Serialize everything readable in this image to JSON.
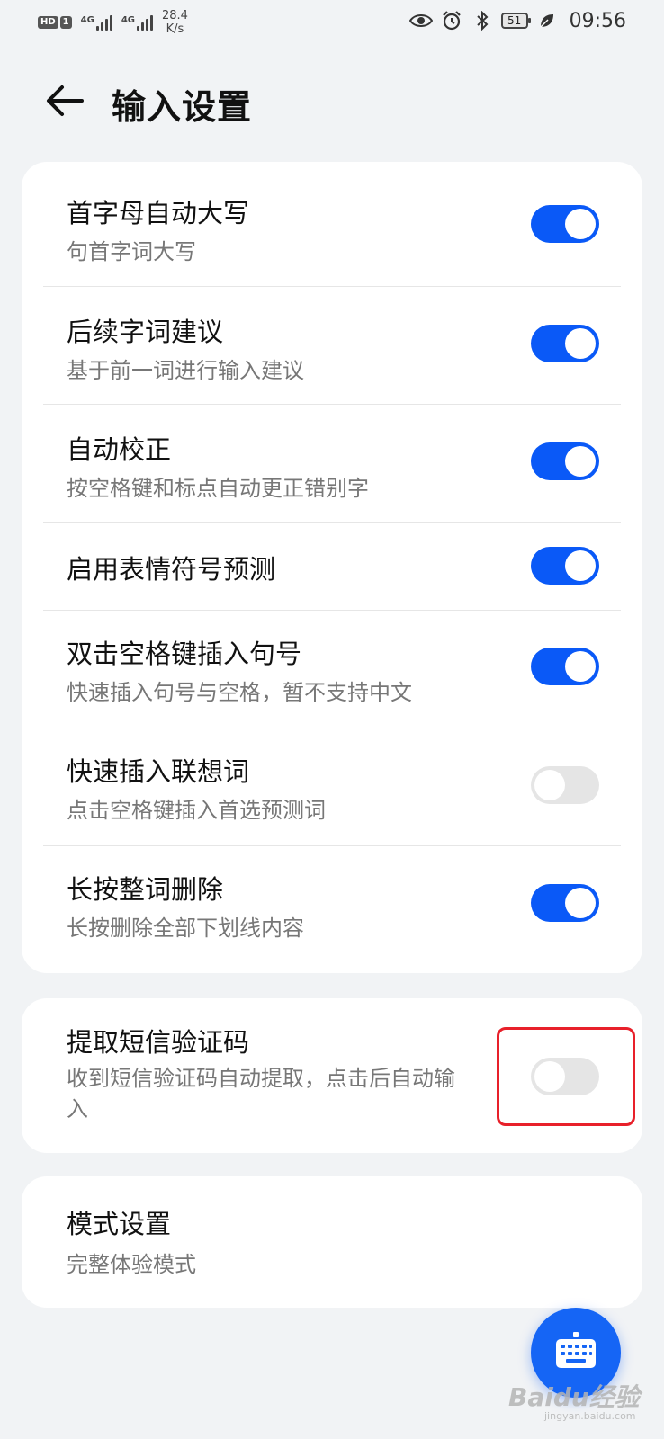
{
  "status": {
    "net_speed_value": "28.4",
    "net_speed_unit": "K/s",
    "signal1": "4G",
    "signal2": "4G",
    "battery": "51",
    "time": "09:56"
  },
  "header": {
    "title": "输入设置"
  },
  "group1": [
    {
      "title": "首字母自动大写",
      "subtitle": "句首字词大写",
      "on": true
    },
    {
      "title": "后续字词建议",
      "subtitle": "基于前一词进行输入建议",
      "on": true
    },
    {
      "title": "自动校正",
      "subtitle": "按空格键和标点自动更正错别字",
      "on": true
    },
    {
      "title": "启用表情符号预测",
      "subtitle": "",
      "on": true
    },
    {
      "title": "双击空格键插入句号",
      "subtitle": "快速插入句号与空格，暂不支持中文",
      "on": true
    },
    {
      "title": "快速插入联想词",
      "subtitle": "点击空格键插入首选预测词",
      "on": false
    },
    {
      "title": "长按整词删除",
      "subtitle": "长按删除全部下划线内容",
      "on": true
    }
  ],
  "group2": {
    "title": "提取短信验证码",
    "subtitle_line1": "收到短信验证码自动提取，点击后自动输",
    "subtitle_line2": "入",
    "on": false
  },
  "group3": {
    "title": "模式设置",
    "subtitle": "完整体验模式"
  },
  "watermark": {
    "text": "Baidu经验",
    "url": "jingyan.baidu.com"
  },
  "colors": {
    "accent": "#0a59f7",
    "background": "#f1f3f5",
    "highlight": "#e8202a"
  }
}
